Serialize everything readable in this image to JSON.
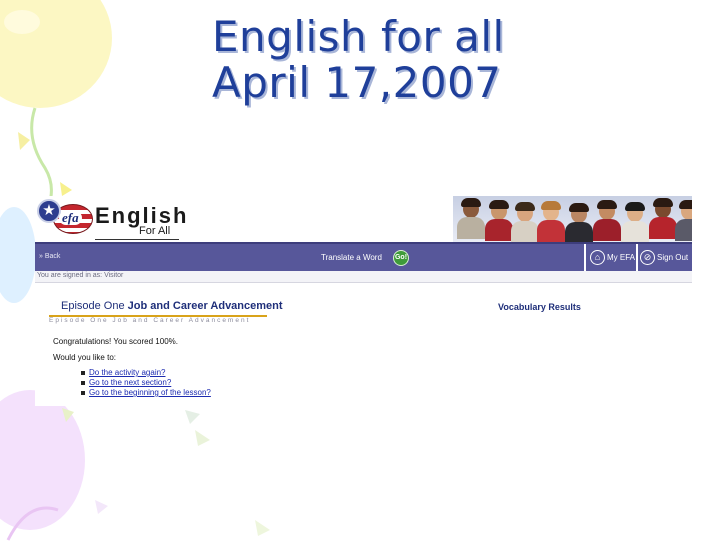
{
  "slide": {
    "title_line1": "English for all",
    "title_line2": "April 17,2007"
  },
  "colors": {
    "title": "#1f3f9a",
    "navbar": "#57579a",
    "episode_title": "#1f2f7a",
    "link": "#1c2bb0",
    "go_button": "#3f9b3a",
    "underline": "#d9a31a"
  },
  "site": {
    "logo_badge": "efa",
    "logo_name": "English",
    "logo_tagline": "For All",
    "nav_left": "» Back",
    "translate_label": "Translate a Word",
    "go_label": "Go!",
    "my_efa": "My EFA",
    "sign_out": "Sign Out",
    "status": "You are signed in as: Visitor"
  },
  "icons": {
    "star": "star-icon",
    "my_efa": "house-icon",
    "sign_out": "sign-out-icon"
  },
  "lesson": {
    "episode_prefix": "Episode One",
    "episode_name": "Job and Career Advancement",
    "episode_subtitle": "Episode One Job and Career Advancement",
    "results_title": "Vocabulary Results",
    "congrats": "Congratulations! You scored 100%.",
    "prompt": "Would you like to:",
    "options": [
      "Do the activity again?",
      "Go to the next section?",
      "Go to the beginning of the lesson?"
    ]
  }
}
